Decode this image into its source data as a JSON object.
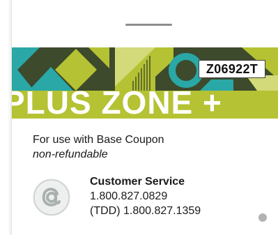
{
  "coupon": {
    "code": "Z06922T",
    "banner_title": "PLUS ZONE +",
    "usage_text": "For use with Base Coupon",
    "usage_note": "non-refundable"
  },
  "customer_service": {
    "title": "Customer Service",
    "phone": "1.800.827.0829",
    "tdd": "(TDD) 1.800.827.1359"
  },
  "logo": {
    "icon": "at-sign-logo-icon"
  },
  "colors": {
    "lime": "#b5c233",
    "dark_olive": "#3d4a2c",
    "teal": "#2aa7a7",
    "light_lime": "#d3da79",
    "dot": "#b3b3b3"
  }
}
